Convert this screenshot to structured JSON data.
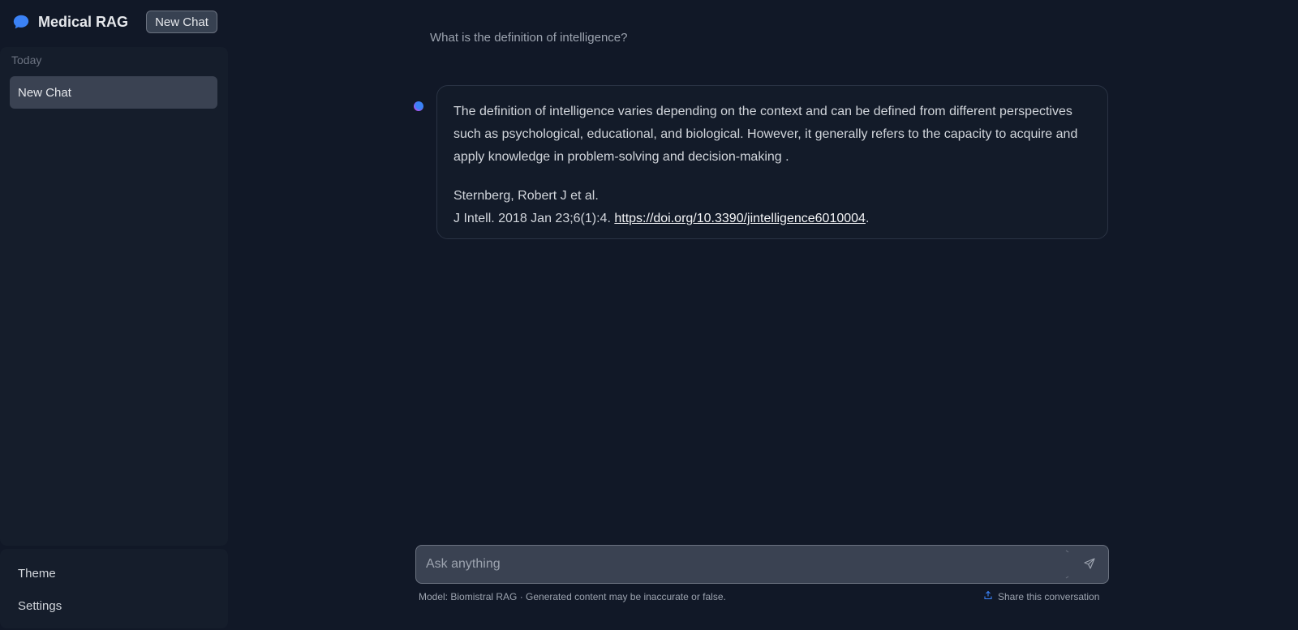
{
  "app": {
    "title": "Medical RAG",
    "new_chat_label": "New Chat"
  },
  "sidebar": {
    "groups": [
      {
        "label": "Today",
        "items": [
          {
            "label": "New Chat",
            "active": true
          }
        ]
      }
    ],
    "bottom_items": [
      {
        "label": "Theme"
      },
      {
        "label": "Settings"
      }
    ]
  },
  "conversation": {
    "user_message": "What is the definition of intelligence?",
    "assistant_message": {
      "text": "The definition of intelligence varies depending on the context and can be defined from different perspectives such as psychological, educational, and biological. However, it generally refers to the capacity to acquire and apply knowledge in problem-solving and decision-making .",
      "reference_authors": "Sternberg, Robert J et al.",
      "reference_citation": "J Intell. 2018 Jan 23;6(1):4.",
      "reference_link": "https://doi.org/10.3390/jintelligence6010004",
      "reference_trailing": "."
    }
  },
  "composer": {
    "placeholder": "Ask anything",
    "value": ""
  },
  "footer": {
    "model_note": "Model: Biomistral RAG · Generated content may be inaccurate or false.",
    "share_label": "Share this conversation"
  },
  "icons": {
    "logo": "chat-bubble-icon",
    "send": "send-icon",
    "share": "share-icon"
  },
  "colors": {
    "accent": "#3b82f6",
    "background": "#111827",
    "panel": "#151d2b",
    "active_item": "#3a4252"
  }
}
